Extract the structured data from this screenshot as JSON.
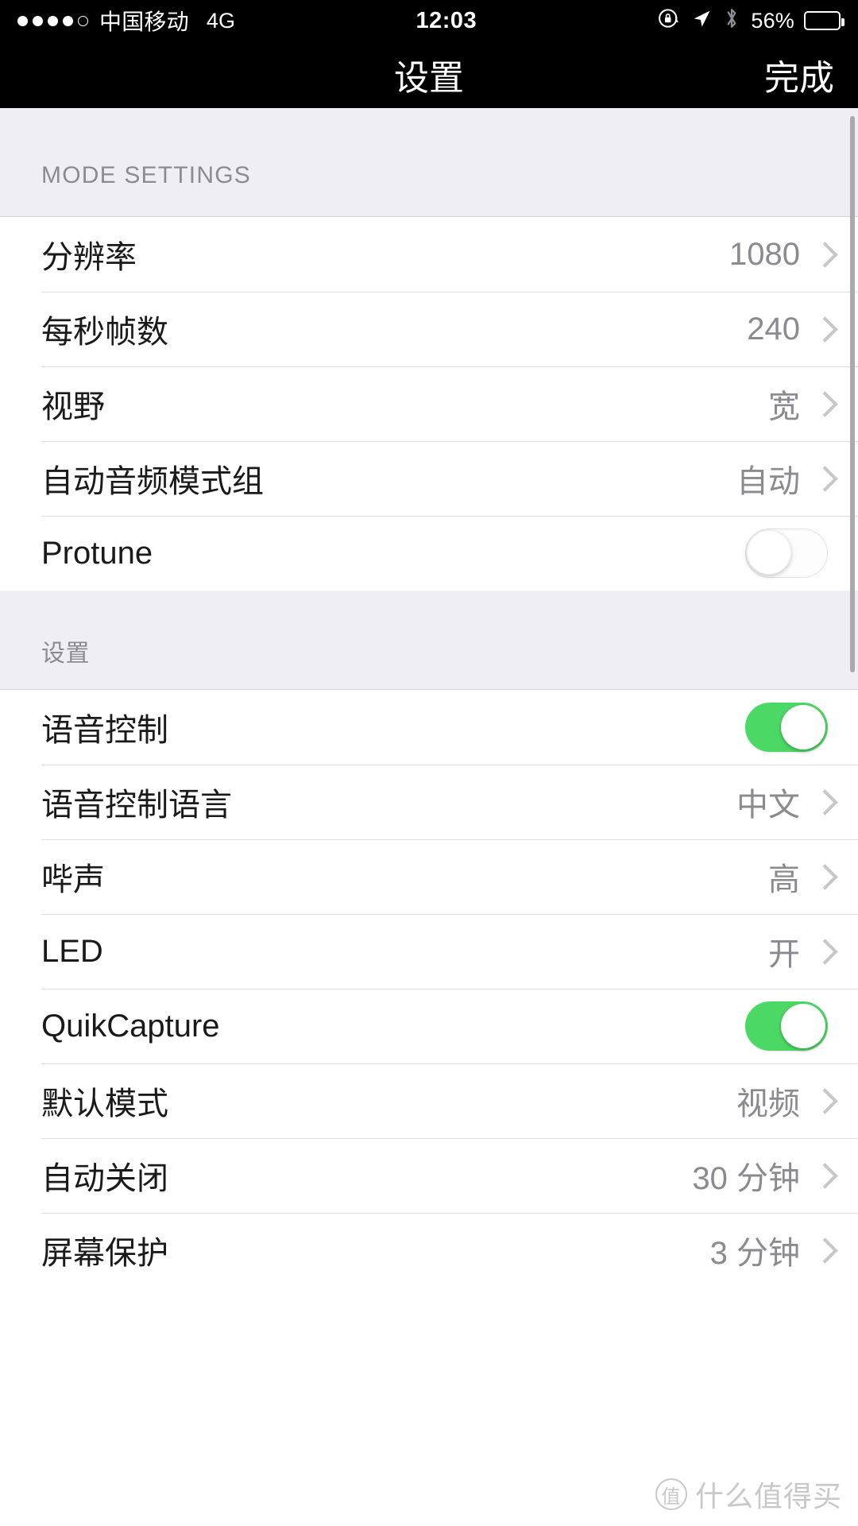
{
  "status_bar": {
    "signal_dots_filled": 4,
    "signal_dots_total": 5,
    "carrier": "中国移动",
    "network": "4G",
    "time": "12:03",
    "battery_percent": "56%",
    "battery_level": 56,
    "icons": [
      "rotation-lock-icon",
      "location-arrow-icon",
      "bluetooth-icon"
    ]
  },
  "nav": {
    "title": "设置",
    "action": "完成"
  },
  "sections": [
    {
      "header": "MODE SETTINGS",
      "rows": [
        {
          "label": "分辨率",
          "value": "1080",
          "type": "disclosure"
        },
        {
          "label": "每秒帧数",
          "value": "240",
          "type": "disclosure"
        },
        {
          "label": "视野",
          "value": "宽",
          "type": "disclosure"
        },
        {
          "label": "自动音频模式组",
          "value": "自动",
          "type": "disclosure"
        },
        {
          "label": "Protune",
          "value": "",
          "type": "toggle",
          "toggle_on": false
        }
      ]
    },
    {
      "header": "设置",
      "rows": [
        {
          "label": "语音控制",
          "value": "",
          "type": "toggle",
          "toggle_on": true
        },
        {
          "label": "语音控制语言",
          "value": "中文",
          "type": "disclosure"
        },
        {
          "label": "哔声",
          "value": "高",
          "type": "disclosure"
        },
        {
          "label": "LED",
          "value": "开",
          "type": "disclosure"
        },
        {
          "label": "QuikCapture",
          "value": "",
          "type": "toggle",
          "toggle_on": true
        },
        {
          "label": "默认模式",
          "value": "视频",
          "type": "disclosure"
        },
        {
          "label": "自动关闭",
          "value": "30 分钟",
          "type": "disclosure"
        },
        {
          "label": "屏幕保护",
          "value": "3 分钟",
          "type": "disclosure"
        }
      ]
    }
  ],
  "watermark": {
    "badge": "值",
    "text": "什么值得买"
  },
  "colors": {
    "toggle_on": "#4CD864",
    "nav_background": "#000000",
    "section_header_background": "#EEEEF4",
    "value_text": "#8A8A8F"
  }
}
